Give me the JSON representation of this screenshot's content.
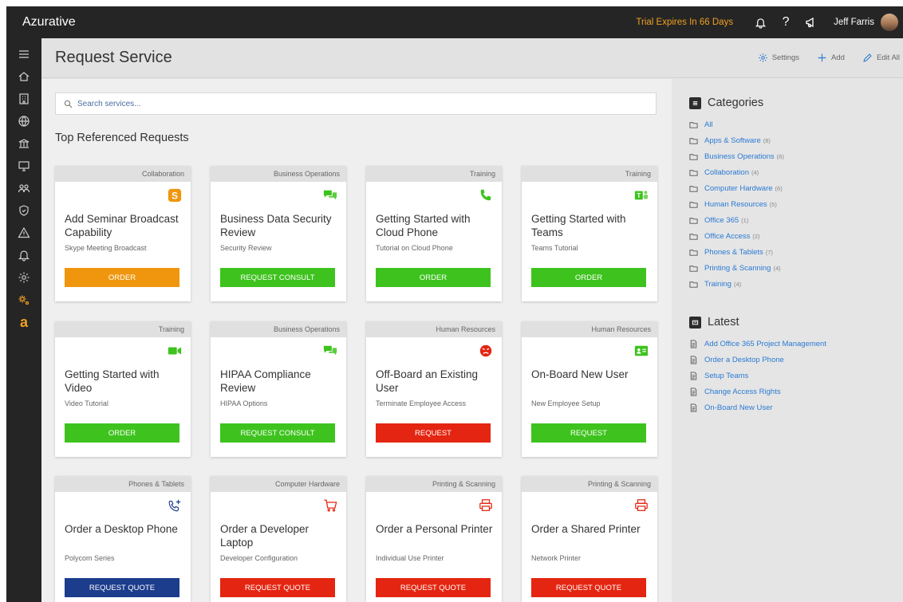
{
  "app": {
    "title": "Azurative",
    "trial_text": "Trial Expires In 66 Days",
    "user_name": "Jeff Farris"
  },
  "header": {
    "title": "Request Service",
    "settings_label": "Settings",
    "add_label": "Add",
    "edit_label": "Edit All"
  },
  "search": {
    "placeholder": "Search services..."
  },
  "section_title": "Top Referenced Requests",
  "cards": [
    {
      "category": "Collaboration",
      "title": "Add Seminar Broadcast Capability",
      "subtitle": "Skype Meeting Broadcast",
      "button": "ORDER",
      "button_color": "#f0960e",
      "icon": "skype-icon",
      "icon_color": "#f0960e"
    },
    {
      "category": "Business Operations",
      "title": "Business Data Security Review",
      "subtitle": "Security Review",
      "button": "REQUEST CONSULT",
      "button_color": "#3ec31e",
      "icon": "chat-bubbles-icon",
      "icon_color": "#3ec31e"
    },
    {
      "category": "Training",
      "title": "Getting Started with Cloud Phone",
      "subtitle": "Tutorial on Cloud Phone",
      "button": "ORDER",
      "button_color": "#3ec31e",
      "icon": "phone-icon",
      "icon_color": "#3ec31e"
    },
    {
      "category": "Training",
      "title": "Getting Started with Teams",
      "subtitle": "Teams Tutorial",
      "button": "ORDER",
      "button_color": "#3ec31e",
      "icon": "teams-icon",
      "icon_color": "#3ec31e"
    },
    {
      "category": "Training",
      "title": "Getting Started with Video",
      "subtitle": "Video Tutorial",
      "button": "ORDER",
      "button_color": "#3ec31e",
      "icon": "video-camera-icon",
      "icon_color": "#3ec31e"
    },
    {
      "category": "Business Operations",
      "title": "HIPAA Compliance Review",
      "subtitle": "HIPAA Options",
      "button": "REQUEST CONSULT",
      "button_color": "#3ec31e",
      "icon": "chat-bubbles-icon",
      "icon_color": "#3ec31e"
    },
    {
      "category": "Human Resources",
      "title": "Off-Board an Existing User",
      "subtitle": "Terminate Employee Access",
      "button": "REQUEST",
      "button_color": "#e42511",
      "icon": "angry-face-icon",
      "icon_color": "#e42511"
    },
    {
      "category": "Human Resources",
      "title": "On-Board New User",
      "subtitle": "New Employee Setup",
      "button": "REQUEST",
      "button_color": "#3ec31e",
      "icon": "contact-card-icon",
      "icon_color": "#3ec31e"
    },
    {
      "category": "Phones & Tablets",
      "title": "Order a Desktop Phone",
      "subtitle": "Polycom Series",
      "button": "REQUEST QUOTE",
      "button_color": "#1c3c8c",
      "icon": "phone-add-icon",
      "icon_color": "#1c3c8c"
    },
    {
      "category": "Computer Hardware",
      "title": "Order a Developer Laptop",
      "subtitle": "Developer Configuration",
      "button": "REQUEST QUOTE",
      "button_color": "#e42511",
      "icon": "shopping-cart-icon",
      "icon_color": "#e42511"
    },
    {
      "category": "Printing & Scanning",
      "title": "Order a Personal Printer",
      "subtitle": "Individual Use Printer",
      "button": "REQUEST QUOTE",
      "button_color": "#e42511",
      "icon": "printer-icon",
      "icon_color": "#e42511"
    },
    {
      "category": "Printing & Scanning",
      "title": "Order a Shared Printer",
      "subtitle": "Network Printer",
      "button": "REQUEST QUOTE",
      "button_color": "#e42511",
      "icon": "printer-icon",
      "icon_color": "#e42511"
    }
  ],
  "categories": {
    "title": "Categories",
    "items": [
      {
        "label": "All",
        "count": ""
      },
      {
        "label": "Apps & Software",
        "count": "(8)"
      },
      {
        "label": "Business Operations",
        "count": "(6)"
      },
      {
        "label": "Collaboration",
        "count": "(4)"
      },
      {
        "label": "Computer Hardware",
        "count": "(6)"
      },
      {
        "label": "Human Resources",
        "count": "(5)"
      },
      {
        "label": "Office 365",
        "count": "(1)"
      },
      {
        "label": "Office Access",
        "count": "(2)"
      },
      {
        "label": "Phones & Tablets",
        "count": "(7)"
      },
      {
        "label": "Printing & Scanning",
        "count": "(4)"
      },
      {
        "label": "Training",
        "count": "(4)"
      }
    ]
  },
  "latest": {
    "title": "Latest",
    "items": [
      {
        "label": "Add Office 365 Project Management"
      },
      {
        "label": "Order a Desktop Phone"
      },
      {
        "label": "Setup Teams"
      },
      {
        "label": "Change Access Rights"
      },
      {
        "label": "On-Board New User"
      }
    ]
  },
  "colors": {
    "topbar_bg": "#252525",
    "accent_blue": "#2a7ad4",
    "trial_orange": "#f0a020"
  }
}
